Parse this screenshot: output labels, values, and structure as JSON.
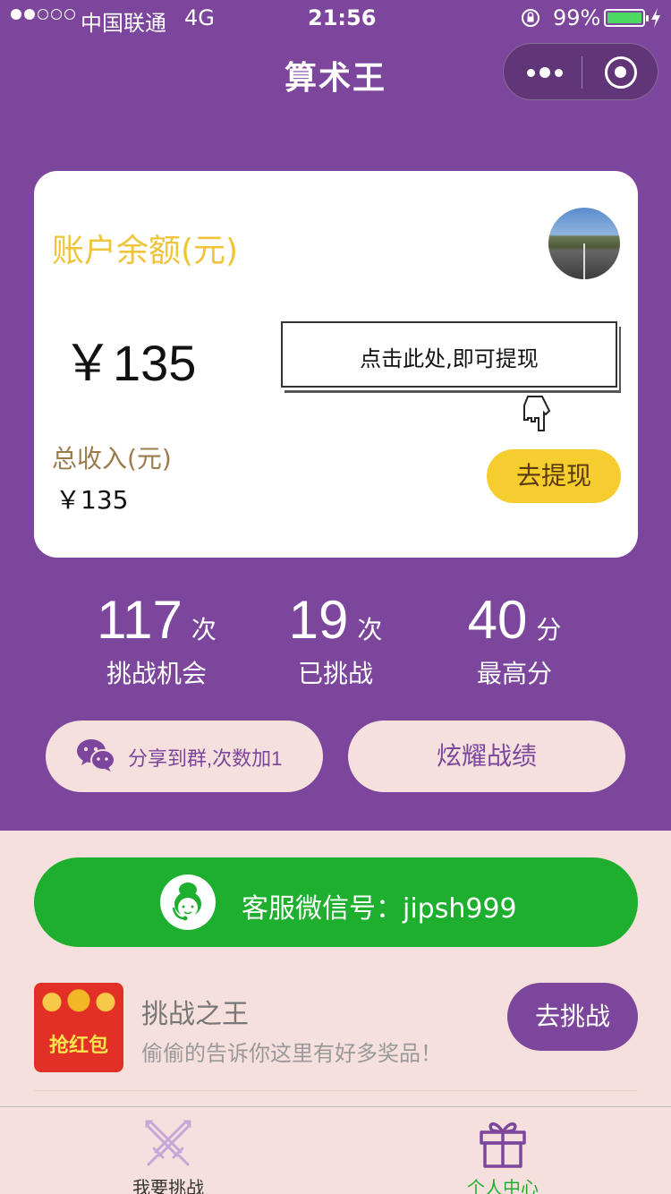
{
  "status_bar": {
    "carrier": "中国联通",
    "network": "4G",
    "time": "21:56",
    "battery": "99%"
  },
  "nav": {
    "title": "算术王"
  },
  "card": {
    "balance_label": "账户余额(元)",
    "balance_amount": "￥135",
    "tip": "点击此处,即可提现",
    "income_label": "总收入(元)",
    "income_amount": "￥135",
    "withdraw_button": "去提现"
  },
  "stats": [
    {
      "value": "117",
      "unit": "次",
      "label": "挑战机会"
    },
    {
      "value": "19",
      "unit": "次",
      "label": "已挑战"
    },
    {
      "value": "40",
      "unit": "分",
      "label": "最高分"
    }
  ],
  "actions": {
    "share": "分享到群,次数加1",
    "show": "炫耀战绩"
  },
  "service": {
    "text": "客服微信号：jipsh999"
  },
  "challenge": {
    "badge": "抢红包",
    "title": "挑战之王",
    "desc": "偷偷的告诉你这里有好多奖品！",
    "button": "去挑战"
  },
  "tabbar": {
    "tabs": [
      {
        "label": "我要挑战",
        "icon": "crossed-swords-icon"
      },
      {
        "label": "个人中心",
        "icon": "gift-icon"
      }
    ]
  },
  "colors": {
    "primary_purple": "#7C469C",
    "background_pink": "#F6E0DD",
    "accent_yellow": "#F5CD2F",
    "service_green": "#1FAF2F"
  }
}
